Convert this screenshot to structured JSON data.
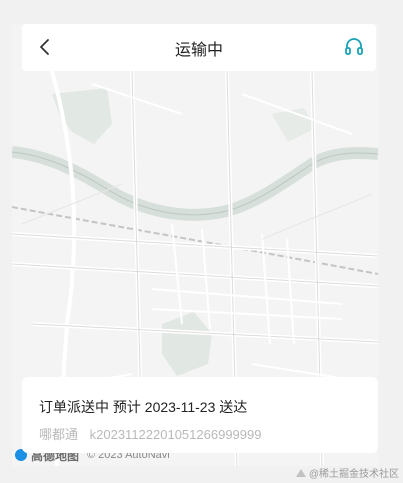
{
  "header": {
    "title": "运输中",
    "back_icon": "chevron-left-icon",
    "service_icon": "headset-icon",
    "accent": "#1aa3b8"
  },
  "order": {
    "status_text": "订单派送中 预计 2023-11-23 送达",
    "carrier": "哪都通",
    "tracking_number": "k20231122201051266999999"
  },
  "map": {
    "attribution_logo": "高德地图",
    "attribution_copyright": "© 2023 AutoNavi"
  },
  "watermark": {
    "text": "@稀土掘金技术社区"
  }
}
